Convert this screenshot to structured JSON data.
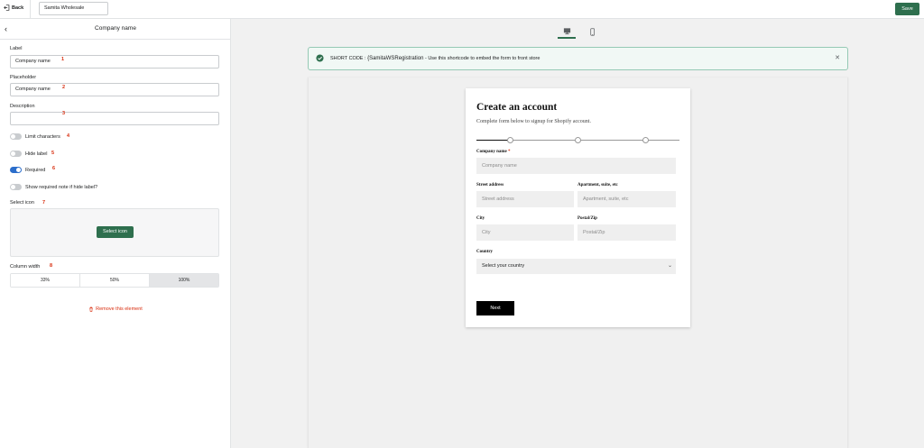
{
  "topbar": {
    "back_label": "Back",
    "app_name": "Samita Wholesale",
    "save_label": "Save",
    "accent": "#2e6f4e"
  },
  "sidebar": {
    "title": "Company name",
    "label_field": {
      "label": "Label",
      "value": "Company name",
      "marker": "1"
    },
    "placeholder_field": {
      "label": "Placeholder",
      "value": "Company name",
      "marker": "2"
    },
    "description_field": {
      "label": "Description",
      "value": "",
      "marker": "3"
    },
    "toggles": [
      {
        "label": "Limit characters",
        "on": false,
        "marker": "4"
      },
      {
        "label": "Hide label",
        "on": false,
        "marker": "5"
      },
      {
        "label": "Required",
        "on": true,
        "marker": "6"
      },
      {
        "label": "Show required note if hide label?",
        "on": false,
        "marker": ""
      }
    ],
    "select_icon": {
      "label": "Select icon",
      "button": "Select icon",
      "marker": "7"
    },
    "column_width": {
      "label": "Column width",
      "options": [
        "33%",
        "50%",
        "100%"
      ],
      "selected": "100%",
      "marker": "8"
    },
    "remove_label": "Remove this element"
  },
  "preview": {
    "devices": [
      "desktop-icon",
      "mobile-icon"
    ],
    "active_device": "desktop-icon",
    "shortcode": {
      "prefix": "SHORT CODE :",
      "code": "{SamitaWSRegistration",
      "description": "- Use this shortcode to embed the form to front store"
    },
    "form": {
      "title": "Create an account",
      "subtitle": "Complete form below to signup for Shopify account.",
      "steps_total": 4,
      "steps_done": 1,
      "fields": {
        "company_label": "Company name",
        "company_placeholder": "Company name",
        "street_label": "Street address",
        "street_placeholder": "Street address",
        "apartment_label": "Apartment, suite, etc",
        "apartment_placeholder": "Apartment, suite, etc",
        "city_label": "City",
        "city_placeholder": "City",
        "postal_label": "Postal/Zip",
        "postal_placeholder": "Postal/Zip",
        "country_label": "Country",
        "country_value": "Select your country"
      },
      "next_label": "Next"
    }
  }
}
